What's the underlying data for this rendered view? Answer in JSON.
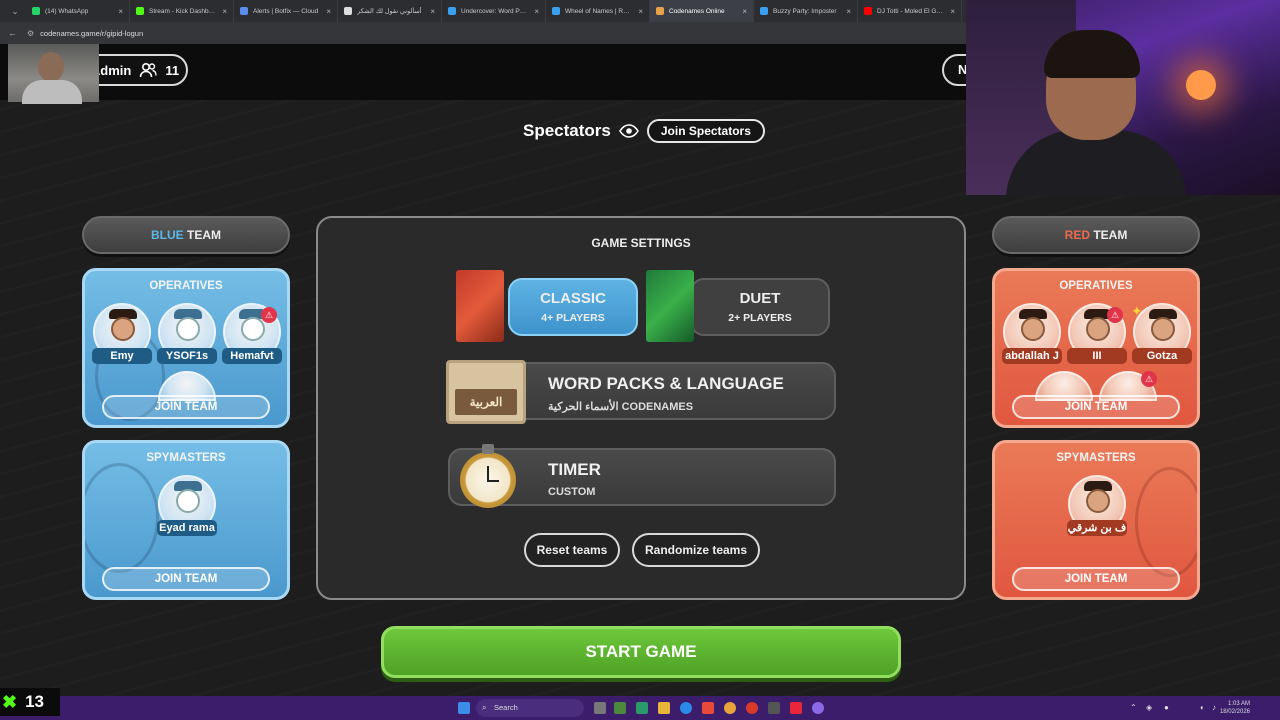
{
  "browser": {
    "tabs": [
      {
        "label": "(14) WhatsApp",
        "color": "#25d366",
        "active": false
      },
      {
        "label": "Stream - Kick Dashboard",
        "color": "#53fc18",
        "active": false
      },
      {
        "label": "Alerts | Botfix — Cloud",
        "color": "#5a8dee",
        "active": false
      },
      {
        "label": "أسألوني نقول لك الشكر",
        "color": "#dddddd",
        "active": false
      },
      {
        "label": "Undercover: Word Party",
        "color": "#3aa0f0",
        "active": false
      },
      {
        "label": "Wheel of Names | Rand",
        "color": "#3aa0f0",
        "active": false
      },
      {
        "label": "Codenames Online",
        "color": "#e8a04a",
        "active": true
      },
      {
        "label": "Buzzy Party: Imposter",
        "color": "#3aa0f0",
        "active": false
      },
      {
        "label": "DJ Totti - Moled El Gezo",
        "color": "#ff0000",
        "active": false
      }
    ],
    "url": "codenames.game/r/gipid-logun"
  },
  "header": {
    "admin_label": "Admin",
    "player_count": "11",
    "right_pill_label": "N"
  },
  "spectators": {
    "title": "Spectators",
    "join_label": "Join Spectators"
  },
  "blue_team": {
    "name_colored": "BLUE",
    "name_rest": " TEAM",
    "operatives_title": "OPERATIVES",
    "operatives": [
      "Emy",
      "YSOF1s",
      "Hemafvt"
    ],
    "join_operatives": "JOIN TEAM",
    "spymasters_title": "SPYMASTERS",
    "spymasters": [
      "Eyad rama"
    ],
    "join_spymasters": "JOIN TEAM"
  },
  "red_team": {
    "name_colored": "RED",
    "name_rest": " TEAM",
    "operatives_title": "OPERATIVES",
    "operatives": [
      "abdallah J",
      "III",
      "Gotza"
    ],
    "join_operatives": "JOIN TEAM",
    "spymasters_title": "SPYMASTERS",
    "spymasters": [
      "ف بن شرقي"
    ],
    "join_spymasters": "JOIN TEAM"
  },
  "settings": {
    "title": "GAME SETTINGS",
    "modes": [
      {
        "name": "CLASSIC",
        "players": "4+ PLAYERS",
        "selected": true
      },
      {
        "name": "DUET",
        "players": "2+ PLAYERS",
        "selected": false
      }
    ],
    "word_packs": {
      "title": "WORD PACKS & LANGUAGE",
      "subtitle": "الأسماء الحركية CODENAMES",
      "card_text": "العربية"
    },
    "timer": {
      "title": "TIMER",
      "value": "CUSTOM"
    },
    "reset_label": "Reset teams",
    "randomize_label": "Randomize teams"
  },
  "start_label": "START GAME",
  "stream": {
    "viewer_count": "13"
  },
  "taskbar": {
    "search_placeholder": "Search",
    "time": "1:03 AM",
    "date": "18/02/2026"
  }
}
